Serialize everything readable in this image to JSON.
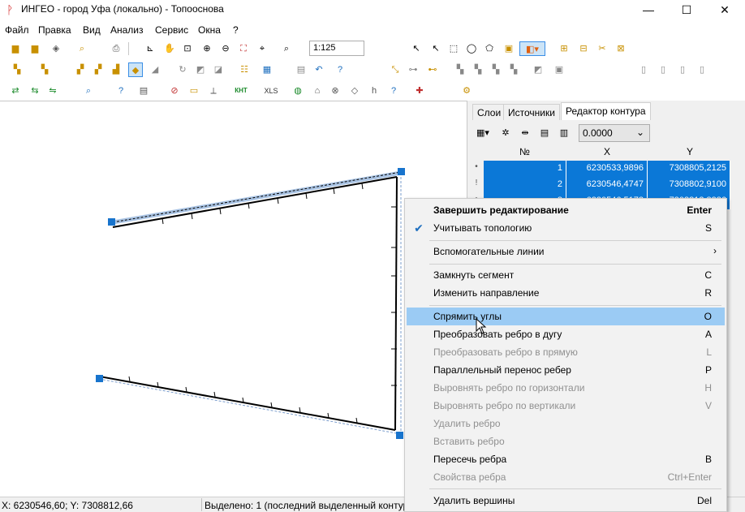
{
  "window": {
    "title": "ИНГЕО - город Уфа (локально) - Топооснова",
    "minimize": "—",
    "maximize": "☐",
    "close": "✕"
  },
  "menu": [
    "Файл",
    "Правка",
    "Вид",
    "Анализ",
    "Сервис",
    "Окна",
    "?"
  ],
  "toolbar": {
    "scale": "1:125",
    "xls_label": "XLS",
    "knt_label": "КНТ"
  },
  "right_panel": {
    "tabs": [
      "Слои",
      "Источники",
      "Редактор контура"
    ],
    "active_tab": "Редактор контура",
    "tolerance_value": "0.0000",
    "columns": [
      "№",
      "X",
      "Y"
    ],
    "rows": [
      {
        "n": "1",
        "x": "6230533,9896",
        "y": "7308805,2125"
      },
      {
        "n": "2",
        "x": "6230546,4747",
        "y": "7308802,9100"
      },
      {
        "n": "3",
        "x": "6230546,5172",
        "y": "7308813,8386"
      }
    ]
  },
  "context_menu": {
    "items": [
      {
        "label": "Завершить редактирование",
        "shortcut": "Enter",
        "bold": true,
        "disabled": false
      },
      {
        "label": "Учитывать топологию",
        "shortcut": "S",
        "checked": true,
        "disabled": false
      },
      {
        "label": "Вспомогательные линии",
        "shortcut": "",
        "submenu": true,
        "disabled": false
      },
      {
        "label": "Замкнуть сегмент",
        "shortcut": "C",
        "disabled": false
      },
      {
        "label": "Изменить направление",
        "shortcut": "R",
        "disabled": false
      },
      {
        "label": "Спрямить углы",
        "shortcut": "O",
        "highlighted": true,
        "disabled": false
      },
      {
        "label": "Преобразовать ребро в дугу",
        "shortcut": "A",
        "disabled": false
      },
      {
        "label": "Преобразовать ребро в прямую",
        "shortcut": "L",
        "disabled": true
      },
      {
        "label": "Параллельный перенос ребер",
        "shortcut": "P",
        "disabled": false
      },
      {
        "label": "Выровнять ребро по горизонтали",
        "shortcut": "H",
        "disabled": true
      },
      {
        "label": "Выровнять ребро по вертикали",
        "shortcut": "V",
        "disabled": true
      },
      {
        "label": "Удалить ребро",
        "shortcut": "",
        "disabled": true
      },
      {
        "label": "Вставить ребро",
        "shortcut": "",
        "disabled": true
      },
      {
        "label": "Пересечь ребра",
        "shortcut": "B",
        "disabled": false
      },
      {
        "label": "Свойства ребра",
        "shortcut": "Ctrl+Enter",
        "disabled": true
      },
      {
        "label": "Удалить вершины",
        "shortcut": "Del",
        "disabled": false
      }
    ],
    "submenu_arrow": "›",
    "check_mark": "✔"
  },
  "status": {
    "coords": "X: 6230546,60; Y: 7308812,66",
    "selection": "Выделено: 1 (последний выделенный контур"
  },
  "colors": {
    "selection": "#0b78d7",
    "highlight": "#9bcbf4",
    "handle": "#1874cd"
  }
}
